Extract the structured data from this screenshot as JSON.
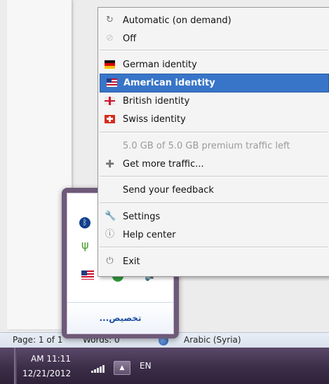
{
  "menu": {
    "items": [
      {
        "label": "Automatic (on demand)",
        "icon": "refresh-icon"
      },
      {
        "label": "Off",
        "icon": "off-icon"
      },
      {
        "label": "German identity",
        "icon": "germany-flag-icon"
      },
      {
        "label": "American identity",
        "icon": "usa-flag-icon"
      },
      {
        "label": "British identity",
        "icon": "uk-flag-icon"
      },
      {
        "label": "Swiss identity",
        "icon": "switzerland-flag-icon"
      },
      {
        "label": "5.0 GB of 5.0 GB premium traffic left"
      },
      {
        "label": "Get more traffic...",
        "icon": "plus-icon"
      },
      {
        "label": "Send your feedback"
      },
      {
        "label": "Settings",
        "icon": "wrench-icon"
      },
      {
        "label": "Help center",
        "icon": "help-icon"
      },
      {
        "label": "Exit",
        "icon": "exit-icon"
      }
    ],
    "selected": "American identity"
  },
  "tray_flyout": {
    "customize_link": "تخصيص..."
  },
  "statusbar": {
    "page": "Page: 1 of 1",
    "words": "Words: 0",
    "language": "Arabic (Syria)"
  },
  "taskbar": {
    "time": "AM 11:11",
    "date": "12/21/2012",
    "language": "EN"
  },
  "colors": {
    "menu_highlight": "#3875c8",
    "taskbar": "#3c2d49",
    "tray_link": "#1e4fa1"
  }
}
